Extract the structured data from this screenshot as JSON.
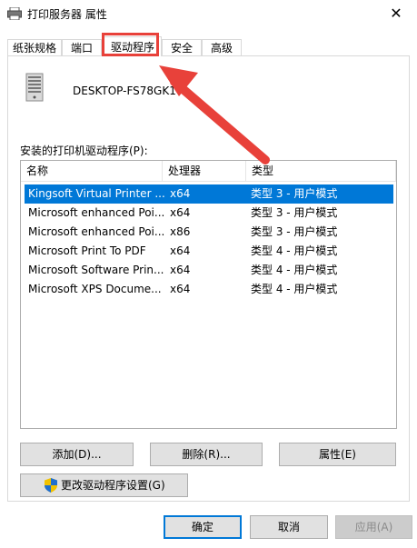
{
  "window": {
    "title": "打印服务器 属性",
    "close_glyph": "✕"
  },
  "tabs": [
    {
      "label": "纸张规格"
    },
    {
      "label": "端口"
    },
    {
      "label": "驱动程序"
    },
    {
      "label": "安全"
    },
    {
      "label": "高级"
    }
  ],
  "server": {
    "name": "DESKTOP-FS78GK1"
  },
  "drivers": {
    "label": "安装的打印机驱动程序(P):",
    "columns": [
      "名称",
      "处理器",
      "类型"
    ],
    "rows": [
      {
        "name": "Kingsoft Virtual Printer ...",
        "processor": "x64",
        "type": "类型 3 - 用户模式"
      },
      {
        "name": "Microsoft enhanced Poi...",
        "processor": "x64",
        "type": "类型 3 - 用户模式"
      },
      {
        "name": "Microsoft enhanced Poi...",
        "processor": "x86",
        "type": "类型 3 - 用户模式"
      },
      {
        "name": "Microsoft Print To PDF",
        "processor": "x64",
        "type": "类型 4 - 用户模式"
      },
      {
        "name": "Microsoft Software Prin...",
        "processor": "x64",
        "type": "类型 4 - 用户模式"
      },
      {
        "name": "Microsoft XPS Docume...",
        "processor": "x64",
        "type": "类型 4 - 用户模式"
      }
    ]
  },
  "actions": {
    "add": "添加(D)...",
    "remove": "删除(R)...",
    "properties": "属性(E)",
    "change_settings": "更改驱动程序设置(G)"
  },
  "footer": {
    "ok": "确定",
    "cancel": "取消",
    "apply": "应用(A)"
  },
  "colors": {
    "selection": "#0078d7",
    "annotation": "#e8413a"
  }
}
